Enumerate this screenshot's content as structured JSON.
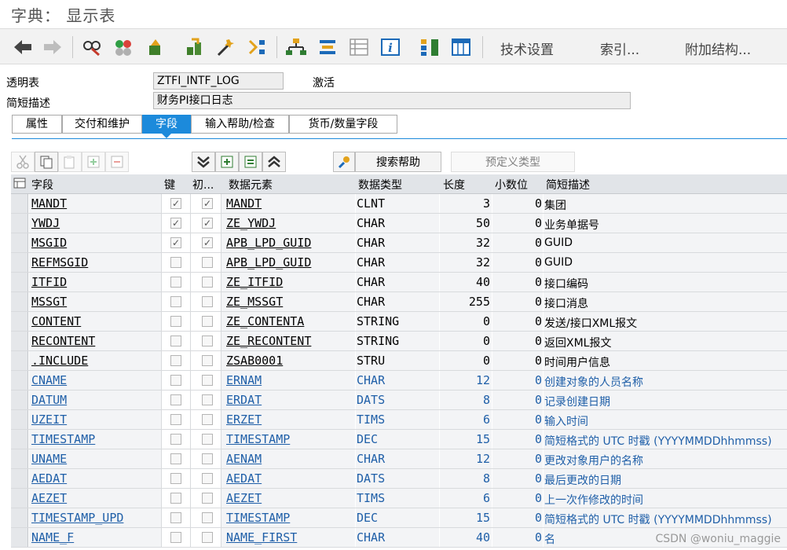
{
  "window": {
    "title": "字典： 显示表"
  },
  "toolbar": {
    "icons": [
      "back-arrow-icon",
      "forward-arrow-icon",
      "display-change-icon",
      "other-object-icon",
      "check-icon",
      "activate-icon",
      "test-icon",
      "where-used-icon",
      "object-list-icon",
      "navigation-window-icon",
      "display-object-list-icon",
      "info-icon",
      "hierarchy-icon",
      "table-contents-icon"
    ],
    "tech_settings": "技术设置",
    "indexes": "索引...",
    "append_structure": "附加结构..."
  },
  "header": {
    "table_type_label": "透明表",
    "table_name": "ZTFI_INTF_LOG",
    "status": "激活",
    "short_desc_label": "简短描述",
    "short_desc": "财务PI接口日志"
  },
  "tabs": [
    {
      "label": "属性",
      "active": false
    },
    {
      "label": "交付和维护",
      "active": false
    },
    {
      "label": "字段",
      "active": true
    },
    {
      "label": "输入帮助/检查",
      "active": false
    },
    {
      "label": "货币/数量字段",
      "active": false
    }
  ],
  "table_toolbar": {
    "search_help": "搜索帮助",
    "predefined_type": "预定义类型"
  },
  "columns": {
    "sel": "",
    "field": "字段",
    "key": "键",
    "init": "初...",
    "data_element": "数据元素",
    "data_type": "数据类型",
    "length": "长度",
    "decimals": "小数位",
    "short_desc": "简短描述"
  },
  "rows": [
    {
      "field": "MANDT",
      "key": true,
      "init": true,
      "data_element": "MANDT",
      "data_type": "CLNT",
      "length": "3",
      "decimals": "0",
      "desc": "集团",
      "blue": false
    },
    {
      "field": "YWDJ",
      "key": true,
      "init": true,
      "data_element": "ZE_YWDJ",
      "data_type": "CHAR",
      "length": "50",
      "decimals": "0",
      "desc": "业务单据号",
      "blue": false
    },
    {
      "field": "MSGID",
      "key": true,
      "init": true,
      "data_element": "APB_LPD_GUID",
      "data_type": "CHAR",
      "length": "32",
      "decimals": "0",
      "desc": "GUID",
      "blue": false
    },
    {
      "field": "REFMSGID",
      "key": false,
      "init": false,
      "data_element": "APB_LPD_GUID",
      "data_type": "CHAR",
      "length": "32",
      "decimals": "0",
      "desc": "GUID",
      "blue": false
    },
    {
      "field": "ITFID",
      "key": false,
      "init": false,
      "data_element": "ZE_ITFID",
      "data_type": "CHAR",
      "length": "40",
      "decimals": "0",
      "desc": "接口编码",
      "blue": false
    },
    {
      "field": "MSSGT",
      "key": false,
      "init": false,
      "data_element": "ZE_MSSGT",
      "data_type": "CHAR",
      "length": "255",
      "decimals": "0",
      "desc": "接口消息",
      "blue": false
    },
    {
      "field": "CONTENT",
      "key": false,
      "init": false,
      "data_element": "ZE_CONTENTA",
      "data_type": "STRING",
      "length": "0",
      "decimals": "0",
      "desc": "发送/接口XML报文",
      "blue": false
    },
    {
      "field": "RECONTENT",
      "key": false,
      "init": false,
      "data_element": "ZE_RECONTENT",
      "data_type": "STRING",
      "length": "0",
      "decimals": "0",
      "desc": "返回XML报文",
      "blue": false
    },
    {
      "field": ".INCLUDE",
      "key": false,
      "init": false,
      "data_element": "ZSAB0001",
      "data_type": "STRU",
      "length": "0",
      "decimals": "0",
      "desc": "时间用户信息",
      "blue": false
    },
    {
      "field": "CNAME",
      "key": false,
      "init": false,
      "data_element": "ERNAM",
      "data_type": "CHAR",
      "length": "12",
      "decimals": "0",
      "desc": "创建对象的人员名称",
      "blue": true
    },
    {
      "field": "DATUM",
      "key": false,
      "init": false,
      "data_element": "ERDAT",
      "data_type": "DATS",
      "length": "8",
      "decimals": "0",
      "desc": "记录创建日期",
      "blue": true
    },
    {
      "field": "UZEIT",
      "key": false,
      "init": false,
      "data_element": "ERZET",
      "data_type": "TIMS",
      "length": "6",
      "decimals": "0",
      "desc": "输入时间",
      "blue": true
    },
    {
      "field": "TIMESTAMP",
      "key": false,
      "init": false,
      "data_element": "TIMESTAMP",
      "data_type": "DEC",
      "length": "15",
      "decimals": "0",
      "desc": "简短格式的 UTC 时戳 (YYYYMMDDhhmmss)",
      "blue": true
    },
    {
      "field": "UNAME",
      "key": false,
      "init": false,
      "data_element": "AENAM",
      "data_type": "CHAR",
      "length": "12",
      "decimals": "0",
      "desc": "更改对象用户的名称",
      "blue": true
    },
    {
      "field": "AEDAT",
      "key": false,
      "init": false,
      "data_element": "AEDAT",
      "data_type": "DATS",
      "length": "8",
      "decimals": "0",
      "desc": "最后更改的日期",
      "blue": true
    },
    {
      "field": "AEZET",
      "key": false,
      "init": false,
      "data_element": "AEZET",
      "data_type": "TIMS",
      "length": "6",
      "decimals": "0",
      "desc": "上一次作修改的时间",
      "blue": true
    },
    {
      "field": "TIMESTAMP_UPD",
      "key": false,
      "init": false,
      "data_element": "TIMESTAMP",
      "data_type": "DEC",
      "length": "15",
      "decimals": "0",
      "desc": "简短格式的 UTC 时戳 (YYYYMMDDhhmmss)",
      "blue": true
    },
    {
      "field": "NAME_F",
      "key": false,
      "init": false,
      "data_element": "NAME_FIRST",
      "data_type": "CHAR",
      "length": "40",
      "decimals": "0",
      "desc": "名",
      "blue": true
    }
  ],
  "watermark": "CSDN @woniu_maggie"
}
